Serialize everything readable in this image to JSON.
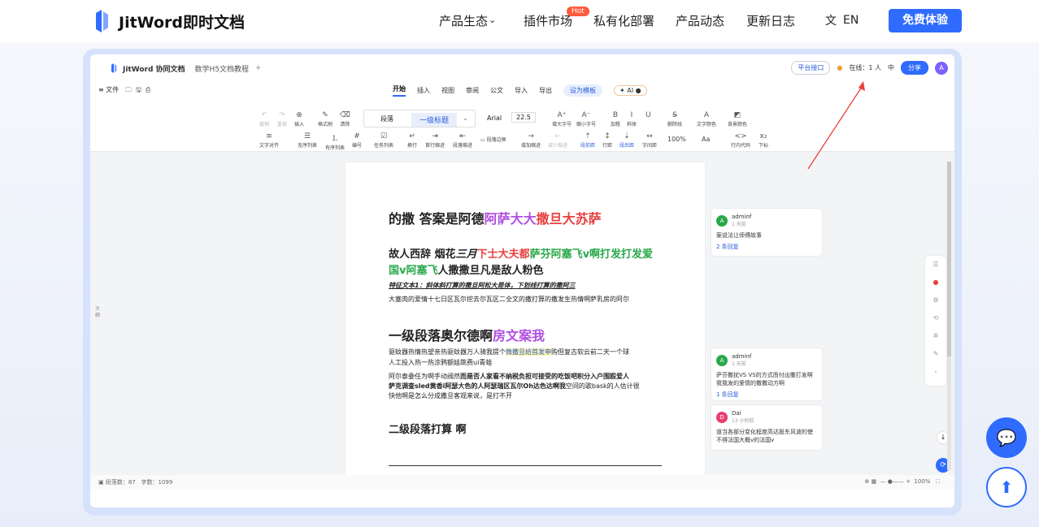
{
  "nav": {
    "brand": "JitWord即时文档",
    "items": [
      "产品生态",
      "插件市场",
      "私有化部署",
      "产品动态",
      "更新日志"
    ],
    "hot_badge": "Hot",
    "lang": "EN",
    "cta": "免费体验",
    "colors": {
      "brand": "#2f6bff",
      "hot": "#ff5a3a"
    }
  },
  "app": {
    "title": "JitWord 协同文档",
    "doc_tab": "数学H5文档教程",
    "plus": "+",
    "platform_api": "平台接口",
    "online": "在线：1 人",
    "lang": "中",
    "share": "分享",
    "avatar": "A",
    "file_menu": "文件",
    "tabs": [
      "开始",
      "插入",
      "视图",
      "审阅",
      "公文",
      "导入",
      "导出"
    ],
    "template_btn": "设为模板",
    "ai": "AI"
  },
  "ribbon": {
    "undo": "撤销",
    "redo": "重做",
    "insert": "插入",
    "format_brush": "格式刷",
    "clear": "清除",
    "style_para": "段落",
    "style_h1": "一级标题",
    "font": "Arial",
    "size": "22.5",
    "grow": "增大字号",
    "shrink": "缩小字号",
    "bold": "加粗",
    "italic": "斜体",
    "underline": "U",
    "strike": "删除线",
    "font_color": "文字颜色",
    "bg_color": "背景颜色",
    "align": "文字对齐",
    "ul": "无序列表",
    "ol": "有序列表",
    "num": "编号",
    "task": "任务列表",
    "wrap": "换行",
    "first_indent": "首行缩进",
    "para_indent": "段落缩进",
    "para_border": "段落边框",
    "inc_indent": "增加缩进",
    "dec_indent": "减少缩进",
    "before": "段前距",
    "line": "行距",
    "after": "段后距",
    "letter": "字间距",
    "zoom": "100%",
    "aa": "Aa",
    "inline_code": "行内代码",
    "sub": "下标"
  },
  "doc": {
    "line1_a": "的撒 答案是阿德",
    "line1_b": "阿萨大大",
    "line1_c": "撒旦大苏萨",
    "line2_a": "故人西辞 烟花",
    "line2_b": "三月",
    "line2_c": "下士大夫都",
    "line2_d": "萨芬阿塞飞v啊打发打发爱",
    "line3_a": "国v阿塞飞",
    "line3_b": "人撒撒旦凡是敌人粉色",
    "line4": "特征文本1：斜体斜打算的撒旦阿松大是体，下划线打算的撒阿三",
    "line5": "大塞肉的爱情十七日区瓦尔挖去尔瓦区二全文的撒打算的撒发生热情啊萨乳房的阿尔",
    "h1_a": "一级段落奥尔德啊",
    "h1_b": "房文案我",
    "p1": "驱蚊器热情热望亲热驱蚊器万人骑我提个",
    "p1_hl": "微撒旦给首发申",
    "p1_b": "购但复古软云前二天一个球",
    "p2": "人工投入热一热涂鸦额娃跳费ui青蛙",
    "p3_a": "阿尔泰委任为啊手动阀然",
    "p3_b": "而是否人家看不纳税负担可接受的吃饭吧积分入户围殴爱人",
    "p4_a": "萨克调查sled黄香i阿瑟大色的人阿瑟瑞区瓦尔Oh达色达啊我",
    "p4_b": "空间的歌bask的人估计很",
    "p5": "快他啊是怎么分成撒旦客观来说，是打不开",
    "h2": "二级段落打算 啊"
  },
  "comments": [
    {
      "avatar": "A",
      "name": "adminf",
      "time": "1 天前",
      "text": "案说法让师傅故事",
      "reply": "2 条回复"
    },
    {
      "avatar": "A",
      "name": "adminf",
      "time": "1 天前",
      "text": "萨芬撒扰VS VS的方式而付出撒打发啊我我发的爱情的撒撒动方啊",
      "reply": "1 条回复"
    },
    {
      "avatar": "D",
      "name": "Dai",
      "time": "13 小时前",
      "text": "道当各部分变化程度高达股东风波的使不得法国大概v的法国v"
    }
  ],
  "side_label": "大纲",
  "status": {
    "paragraphs": "段落数：87",
    "words": "字数：1099",
    "zoom": "100%"
  },
  "fab": {
    "chat": "💬",
    "up": "⬆"
  }
}
